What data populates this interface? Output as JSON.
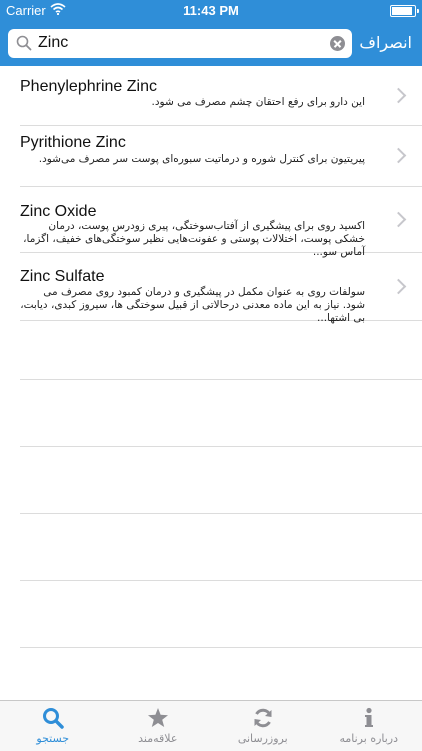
{
  "status_bar": {
    "carrier": "Carrier",
    "time": "11:43 PM"
  },
  "search": {
    "value": "Zinc",
    "cancel_label": "انصراف"
  },
  "results": [
    {
      "title": "Phenylephrine Zinc",
      "description": "این دارو برای رفع احتقان چشم مصرف می شود."
    },
    {
      "title": "Pyrithione Zinc",
      "description": "پیریتیون برای کنترل شوره و درماتیت سبوره‌ای پوست سر مصرف می‌شود."
    },
    {
      "title": "Zinc Oxide",
      "description": "اکسید روی برای پیشگیری از آفتاب‌سوختگی، پیری زودرس پوست، درمان خشکی پوست، اختلالات پوستی و عفونت‌هایی نظیر سوختگی‌های خفیف، اگزما، آماس سو..."
    },
    {
      "title": "Zinc Sulfate",
      "description": "سولفات روی به عنوان مکمل در پیشگیری و درمان کمبود روی مصرف می شود. نیاز به این ماده معدنی درحالاتی از قبیل سوختگی ها، سیروز کبدی، دیابت، بی اشتها..."
    }
  ],
  "tabs": [
    {
      "label": "درباره برنامه",
      "icon": "info-icon"
    },
    {
      "label": "بروزرسانی",
      "icon": "refresh-icon"
    },
    {
      "label": "علاقه‌مند",
      "icon": "star-icon"
    },
    {
      "label": "جستجو",
      "icon": "search-icon",
      "active": true
    }
  ],
  "colors": {
    "accent": "#2f8ed8",
    "tab_inactive": "#8e8e93",
    "separator": "#dcdcdc"
  }
}
